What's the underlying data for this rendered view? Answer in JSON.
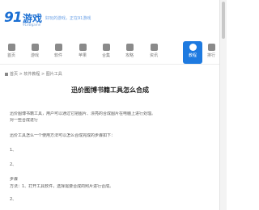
{
  "brand": {
    "logo_number": "91",
    "logo_text": "游戏",
    "logo_subtext": "91xwgame",
    "slogan": "好玩的游戏，正在91游戏"
  },
  "nav": {
    "items": [
      {
        "label": "首页"
      },
      {
        "label": "游戏"
      },
      {
        "label": "软件"
      },
      {
        "label": "苹果"
      },
      {
        "label": "合集"
      },
      {
        "label": "攻略"
      },
      {
        "label": "资讯"
      },
      {
        "label": "教程"
      },
      {
        "label": "排行"
      }
    ]
  },
  "breadcrumb": {
    "text": "首页 > 软件教程 > 图片工具"
  },
  "article": {
    "title": "迅价图博书籍工具怎么合成",
    "meta": "",
    "paragraphs": [
      "迅价图博书籍工具，用户可以通过它把图片、漂亮的合成图片在电脑上进行处理。",
      "对一些合成进行",
      "迅价工具怎么一个使用方法可以怎么合成完成的步骤如下：",
      "1、",
      "2、",
      "步骤",
      "方法：1、打开工具软件，选择需要合成的照片进行合成。",
      "2、"
    ]
  }
}
